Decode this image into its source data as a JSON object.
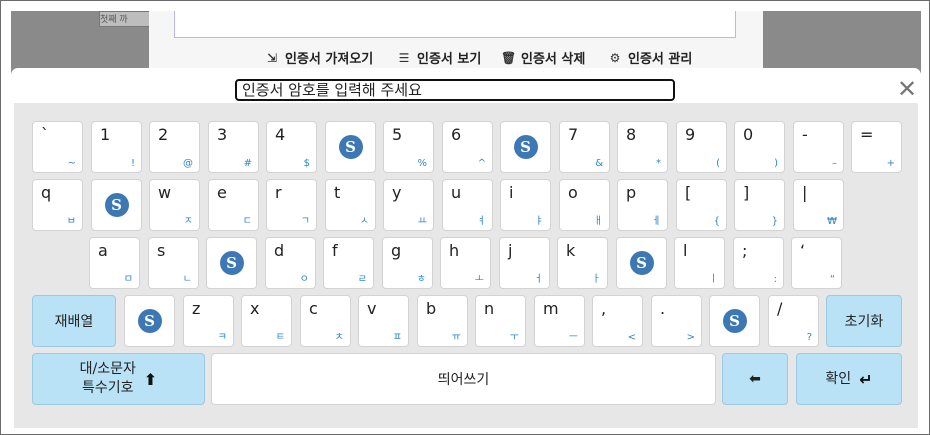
{
  "background": {
    "cell_text": "첫째 까",
    "toolbar": [
      {
        "icon": "import-cert-icon",
        "glyph": "⇲",
        "label": "인증서 가져오기"
      },
      {
        "icon": "view-cert-icon",
        "glyph": "☰",
        "label": "인증서 보기"
      },
      {
        "icon": "trash-icon",
        "glyph": "🗑",
        "label": "인증서 삭제"
      },
      {
        "icon": "gear-icon",
        "glyph": "⚙",
        "label": "인증서 관리"
      }
    ]
  },
  "dialog": {
    "password_placeholder": "인증서 암호를 입력해 주세요",
    "close_glyph": "✕"
  },
  "keyboard": {
    "mix_glyph": "S",
    "rows": [
      [
        [
          "`",
          "~"
        ],
        [
          "1",
          "!"
        ],
        [
          "2",
          "@"
        ],
        [
          "3",
          "#"
        ],
        [
          "4",
          "$"
        ],
        null,
        [
          "5",
          "%"
        ],
        [
          "6",
          "^"
        ],
        null,
        [
          "7",
          "&"
        ],
        [
          "8",
          "*"
        ],
        [
          "9",
          "("
        ],
        [
          "0",
          ")"
        ],
        [
          "-",
          "–"
        ],
        [
          "=",
          "+"
        ]
      ],
      [
        [
          "q",
          "ㅂ"
        ],
        null,
        [
          "w",
          "ㅈ"
        ],
        [
          "e",
          "ㄷ"
        ],
        [
          "r",
          "ㄱ"
        ],
        [
          "t",
          "ㅅ"
        ],
        [
          "y",
          "ㅛ"
        ],
        [
          "u",
          "ㅕ"
        ],
        [
          "i",
          "ㅑ"
        ],
        [
          "o",
          "ㅐ"
        ],
        [
          "p",
          "ㅔ"
        ],
        [
          "[",
          "{"
        ],
        [
          "]",
          "}"
        ],
        [
          "|",
          "₩"
        ]
      ],
      [
        [
          "a",
          "ㅁ"
        ],
        [
          "s",
          "ㄴ"
        ],
        null,
        [
          "d",
          "ㅇ"
        ],
        [
          "f",
          "ㄹ"
        ],
        [
          "g",
          "ㅎ"
        ],
        [
          "h",
          "ㅗ"
        ],
        [
          "j",
          "ㅓ"
        ],
        [
          "k",
          "ㅏ"
        ],
        null,
        [
          "l",
          "ㅣ"
        ],
        [
          ";",
          ":"
        ],
        [
          "‘",
          "“"
        ]
      ],
      [
        null,
        [
          "z",
          "ㅋ"
        ],
        [
          "x",
          "ㅌ"
        ],
        [
          "c",
          "ㅊ"
        ],
        [
          "v",
          "ㅍ"
        ],
        [
          "b",
          "ㅠ"
        ],
        [
          "n",
          "ㅜ"
        ],
        [
          "m",
          "ㅡ"
        ],
        [
          ",",
          "<"
        ],
        [
          ".",
          ">"
        ],
        null,
        [
          "/",
          "?"
        ]
      ]
    ],
    "rearrange_label": "재배열",
    "clear_label": "초기화",
    "shift_label_line1": "대/소문자",
    "shift_label_line2": "특수기호",
    "shift_glyph": "⬆",
    "space_label": "띄어쓰기",
    "backspace_glyph": "⬅",
    "enter_label": "확인",
    "enter_glyph": "↵"
  }
}
